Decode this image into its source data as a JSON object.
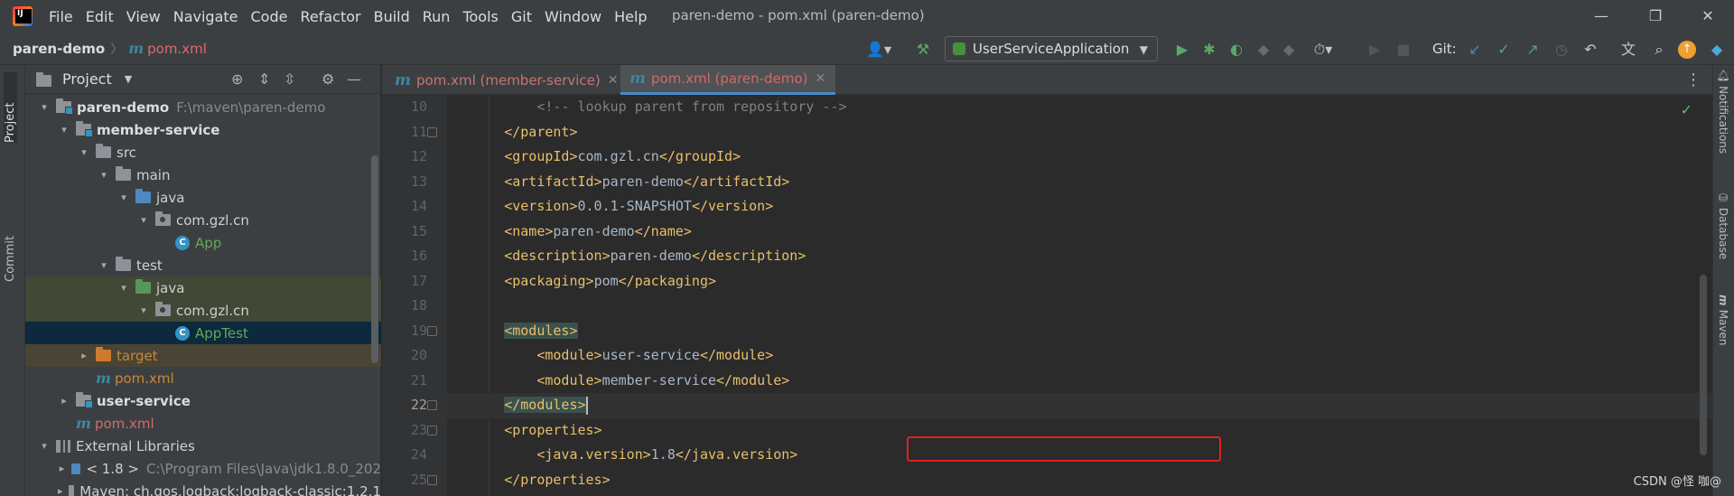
{
  "menu": [
    "File",
    "Edit",
    "View",
    "Navigate",
    "Code",
    "Refactor",
    "Build",
    "Run",
    "Tools",
    "Git",
    "Window",
    "Help"
  ],
  "window_title": "paren-demo - pom.xml (paren-demo)",
  "window_controls": {
    "minimize": "—",
    "restore": "❐",
    "close": "✕"
  },
  "breadcrumb": {
    "project": "paren-demo",
    "file": "pom.xml"
  },
  "toolbar": {
    "run_config": "UserServiceApplication",
    "git_label": "Git:"
  },
  "project_panel": {
    "title": "Project",
    "tree": [
      {
        "arrow": "v",
        "icon": "module-folder",
        "name": "paren-demo",
        "style": "bold",
        "extra": "F:\\maven\\paren-demo"
      },
      {
        "arrow": "v",
        "icon": "module-folder",
        "name": "member-service",
        "style": "bold"
      },
      {
        "arrow": "v",
        "icon": "folder",
        "name": "src"
      },
      {
        "arrow": "v",
        "icon": "folder",
        "name": "main"
      },
      {
        "arrow": "v",
        "icon": "source-folder",
        "name": "java"
      },
      {
        "arrow": "v",
        "icon": "package",
        "name": "com.gzl.cn"
      },
      {
        "arrow": "",
        "icon": "class",
        "name": "App",
        "style": "green"
      },
      {
        "arrow": "v",
        "icon": "folder",
        "name": "test"
      },
      {
        "arrow": "v",
        "icon": "test-folder",
        "name": "java"
      },
      {
        "arrow": "v",
        "icon": "package",
        "name": "com.gzl.cn"
      },
      {
        "arrow": "",
        "icon": "class",
        "name": "AppTest",
        "style": "green"
      },
      {
        "arrow": ">",
        "icon": "excluded-folder",
        "name": "target",
        "style": "orange"
      },
      {
        "arrow": "",
        "icon": "maven",
        "name": "pom.xml",
        "style": "orange"
      },
      {
        "arrow": ">",
        "icon": "module-folder",
        "name": "user-service",
        "style": "bold"
      },
      {
        "arrow": "",
        "icon": "maven",
        "name": "pom.xml",
        "style": "red"
      },
      {
        "arrow": "v",
        "icon": "library",
        "name": "External Libraries"
      },
      {
        "arrow": ">",
        "icon": "jdk",
        "name": "< 1.8 >",
        "extra": "C:\\Program Files\\Java\\jdk1.8.0_202"
      },
      {
        "arrow": ">",
        "icon": "library",
        "name": "Maven: ch.qos.logback:logback-classic:1.2.1"
      }
    ]
  },
  "left_tabs": [
    "Project",
    "Commit"
  ],
  "right_tabs": [
    "Notifications",
    "Database",
    "Maven"
  ],
  "editor_tabs": [
    {
      "label": "pom.xml (member-service)",
      "active": false
    },
    {
      "label": "pom.xml (paren-demo)",
      "active": true
    }
  ],
  "code_lines": [
    {
      "num": "10",
      "indent": "        ",
      "parts": [
        {
          "t": "cmt",
          "v": "<!-- lookup parent from repository -->"
        }
      ]
    },
    {
      "num": "11",
      "indent": "    ",
      "parts": [
        {
          "t": "tag",
          "v": "</parent>"
        }
      ]
    },
    {
      "num": "12",
      "indent": "    ",
      "parts": [
        {
          "t": "tag",
          "v": "<groupId>"
        },
        {
          "t": "txt",
          "v": "com.gzl.cn"
        },
        {
          "t": "tag",
          "v": "</groupId>"
        }
      ]
    },
    {
      "num": "13",
      "indent": "    ",
      "parts": [
        {
          "t": "tag",
          "v": "<artifactId>"
        },
        {
          "t": "txt",
          "v": "paren-demo"
        },
        {
          "t": "tag",
          "v": "</artifactId>"
        }
      ]
    },
    {
      "num": "14",
      "indent": "    ",
      "parts": [
        {
          "t": "tag",
          "v": "<version>"
        },
        {
          "t": "txt",
          "v": "0.0.1-SNAPSHOT"
        },
        {
          "t": "tag",
          "v": "</version>"
        }
      ]
    },
    {
      "num": "15",
      "indent": "    ",
      "parts": [
        {
          "t": "tag",
          "v": "<name>"
        },
        {
          "t": "txt",
          "v": "paren-demo"
        },
        {
          "t": "tag",
          "v": "</name>"
        }
      ]
    },
    {
      "num": "16",
      "indent": "    ",
      "parts": [
        {
          "t": "tag",
          "v": "<description>"
        },
        {
          "t": "txt",
          "v": "paren-demo"
        },
        {
          "t": "tag",
          "v": "</description>"
        }
      ]
    },
    {
      "num": "17",
      "indent": "    ",
      "parts": [
        {
          "t": "tag",
          "v": "<packaging>"
        },
        {
          "t": "txt",
          "v": "pom"
        },
        {
          "t": "tag",
          "v": "</packaging>"
        }
      ]
    },
    {
      "num": "18",
      "indent": "",
      "parts": []
    },
    {
      "num": "19",
      "indent": "    ",
      "parts": [
        {
          "t": "tag hl",
          "v": "<modules>"
        }
      ]
    },
    {
      "num": "20",
      "indent": "        ",
      "parts": [
        {
          "t": "tag",
          "v": "<module>"
        },
        {
          "t": "txt",
          "v": "user-service"
        },
        {
          "t": "tag",
          "v": "</module>"
        }
      ]
    },
    {
      "num": "21",
      "indent": "        ",
      "parts": [
        {
          "t": "tag",
          "v": "<module>"
        },
        {
          "t": "txt",
          "v": "member-service"
        },
        {
          "t": "tag",
          "v": "</module>"
        }
      ]
    },
    {
      "num": "22",
      "indent": "    ",
      "parts": [
        {
          "t": "tag hl",
          "v": "</modules>"
        }
      ],
      "current": true
    },
    {
      "num": "23",
      "indent": "    ",
      "parts": [
        {
          "t": "tag",
          "v": "<properties>"
        }
      ]
    },
    {
      "num": "24",
      "indent": "        ",
      "parts": [
        {
          "t": "tag",
          "v": "<java.version>"
        },
        {
          "t": "txt",
          "v": "1.8"
        },
        {
          "t": "tag",
          "v": "</java.version>"
        }
      ]
    },
    {
      "num": "25",
      "indent": "    ",
      "parts": [
        {
          "t": "tag",
          "v": "</properties>"
        }
      ]
    }
  ],
  "watermark": "CSDN @怪 咖@"
}
